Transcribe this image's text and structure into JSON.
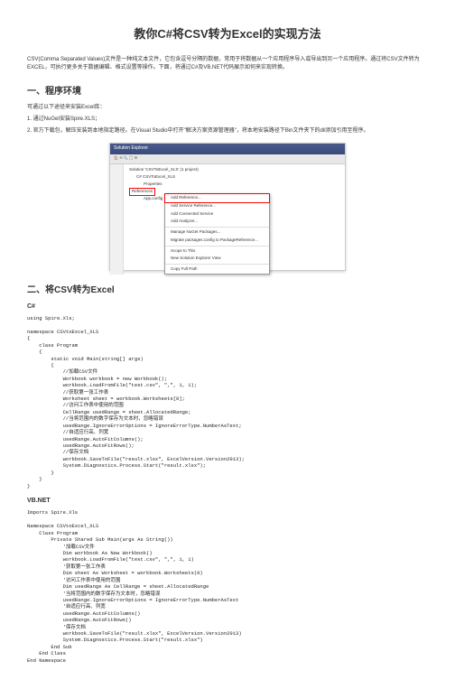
{
  "title": "教你C#将CSV转为Excel的实现方法",
  "intro": "CSV(Comma Separated Values)文件是一种纯文本文件，它包含逗号分隔的数据，常用于将数据从一个应用程序导入或导出到另一个应用程序。通过将CSV文件转为EXCEL，可执行更多关于数据编辑、格式设置等操作。下面，将通过C#及VB.NET代码展示如何来实现转换。",
  "section1": {
    "heading": "一、程序环境",
    "line1": "可通过以下途径来安装Excel库：",
    "line2": "1. 通过NuGet安装Spire.XLS；",
    "line3": "2. 官方下载包，解压安装到本地指定路径。在Visual Studio中打开\"解决方案资源管理器\"，将本地安装路径下Bin文件夹下的dll添加引用至程序。"
  },
  "vs": {
    "title": "Solution Explorer",
    "toolbar": "🏠 ⟲ 🔍 📋 ⚙",
    "solution": "Solution 'CSVToExcel_XLS' (1 project)",
    "project": "C# CSVToExcel_XLS",
    "properties": "Properties",
    "references": "References",
    "appconfig": "App.config",
    "menu": {
      "addref": "Add Reference...",
      "addservice": "Add Service Reference...",
      "addconnected": "Add Connected Service",
      "addanalyzer": "Add Analyzer...",
      "managenuget": "Manage NuGet Packages...",
      "migrate": "Migrate packages.config to PackageReference...",
      "scope": "Scope to This",
      "newview": "New Solution Explorer View",
      "copy": "Copy Full Path"
    }
  },
  "section2": {
    "heading": "二、将CSV转为Excel"
  },
  "csharp_label": "C#",
  "csharp_code": "using Spire.Xls;\n\nnamespace CSVtoExcel_XLS\n{\n    class Program\n    {\n        static void Main(string[] args)\n        {\n            //加载CSV文件\n            Workbook workbook = new Workbook();\n            workbook.LoadFromFile(\"test.csv\", \",\", 1, 1);\n            //获取第一张工作表\n            Worksheet sheet = workbook.Worksheets[0];\n            //访问工作表中使用的范围\n            CellRange usedRange = sheet.AllocatedRange;\n            //当将范围内的数字保存为文本时，忽略错误\n            usedRange.IgnoreErrorOptions = IgnoreErrorType.NumberAsText;\n            //自适应行高、列宽\n            usedRange.AutoFitColumns();\n            usedRange.AutoFitRows();\n            //保存文档\n            workbook.SaveToFile(\"result.xlsx\", ExcelVersion.Version2013);\n            System.Diagnostics.Process.Start(\"result.xlsx\");\n        }\n    }\n}",
  "vbnet_label": "VB.NET",
  "vbnet_code": "Imports Spire.Xls\n\nNamespace CSVtoExcel_XLS\n    Class Program\n        Private Shared Sub Main(args As String())\n            '加载CSV文件\n            Dim workbook As New Workbook()\n            workbook.LoadFromFile(\"test.csv\", \",\", 1, 1)\n            '获取第一张工作表\n            Dim sheet As Worksheet = workbook.Worksheets(0)\n            '访问工作表中使用的范围\n            Dim usedRange As CellRange = sheet.AllocatedRange\n            '当将范围内的数字保存为文本时，忽略错误\n            usedRange.IgnoreErrorOptions = IgnoreErrorType.NumberAsText\n            '自适应行高、列宽\n            usedRange.AutoFitColumns()\n            usedRange.AutoFitRows()\n            '保存文档\n            workbook.SaveToFile(\"result.xlsx\", ExcelVersion.Version2013)\n            System.Diagnostics.Process.Start(\"result.xlsx\")\n        End Sub\n    End Class\nEnd Namespace"
}
